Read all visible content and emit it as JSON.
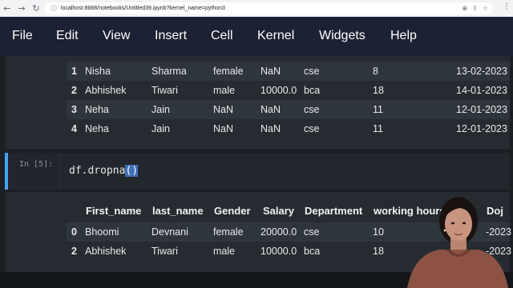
{
  "browser": {
    "back": "←",
    "forward": "→",
    "reload": "↻",
    "info_icon": "ⓘ",
    "url": "localhost:8888/notebooks/Untitled39.ipynb?kernel_name=python3"
  },
  "menu": [
    "File",
    "Edit",
    "View",
    "Insert",
    "Cell",
    "Kernel",
    "Widgets",
    "Help"
  ],
  "output1": {
    "rows": [
      [
        "1",
        "Nisha",
        "Sharma",
        "female",
        "NaN",
        "cse",
        "8",
        "13-02-2023"
      ],
      [
        "2",
        "Abhishek",
        "Tiwari",
        "male",
        "10000.0",
        "bca",
        "18",
        "14-01-2023"
      ],
      [
        "3",
        "Neha",
        "Jain",
        "NaN",
        "NaN",
        "cse",
        "11",
        "12-01-2023"
      ],
      [
        "4",
        "Neha",
        "Jain",
        "NaN",
        "NaN",
        "cse",
        "11",
        "12-01-2023"
      ]
    ]
  },
  "cell": {
    "prompt": "In [5]:",
    "code_prefix": "df.dropna",
    "code_selected": "()"
  },
  "output2": {
    "headers": [
      "First_name",
      "last_name",
      "Gender",
      "Salary",
      "Department",
      "working hours",
      "Doj"
    ],
    "rows": [
      [
        "0",
        "Bhoomi",
        "Devnani",
        "female",
        "20000.0",
        "cse",
        "10",
        "-2023"
      ],
      [
        "2",
        "Abhishek",
        "Tiwari",
        "male",
        "10000.0",
        "bca",
        "18",
        "-2023"
      ]
    ]
  }
}
